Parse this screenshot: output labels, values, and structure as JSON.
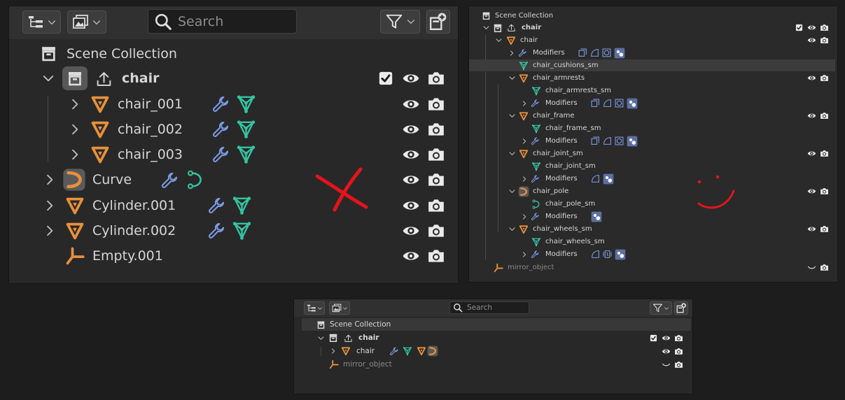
{
  "panel_large": {
    "search_placeholder": "Search",
    "scene_collection": "Scene Collection",
    "chair": "chair",
    "chair_001": "chair_001",
    "chair_002": "chair_002",
    "chair_003": "chair_003",
    "curve": "Curve",
    "cylinder_001": "Cylinder.001",
    "cylinder_002": "Cylinder.002",
    "empty_001": "Empty.001"
  },
  "panel_detail": {
    "scene_collection": "Scene Collection",
    "chair_collection": "chair",
    "chair_object": "chair",
    "modifiers": "Modifiers",
    "chair_cushions_sm": "chair_cushions_sm",
    "chair_armrests": "chair_armrests",
    "chair_armrests_sm": "chair_armrests_sm",
    "chair_frame": "chair_frame",
    "chair_frame_sm": "chair_frame_sm",
    "chair_joint_sm": "chair_joint_sm",
    "chair_joint_sm_mesh": "chair_joint_sm",
    "chair_pole": "chair_pole",
    "chair_pole_sm": "chair_pole_sm",
    "chair_wheels_sm": "chair_wheels_sm",
    "chair_wheels_sm_mesh": "chair_wheels_sm",
    "mirror_object": "mirror_object"
  },
  "panel_small": {
    "search_placeholder": "Search",
    "scene_collection": "Scene Collection",
    "chair_collection": "chair",
    "chair_object": "chair",
    "mirror_object": "mirror_object"
  },
  "colors": {
    "orange": "#e8903c",
    "teal": "#35c3a0",
    "blue": "#7d9be6",
    "red_mark": "#e3141c"
  }
}
